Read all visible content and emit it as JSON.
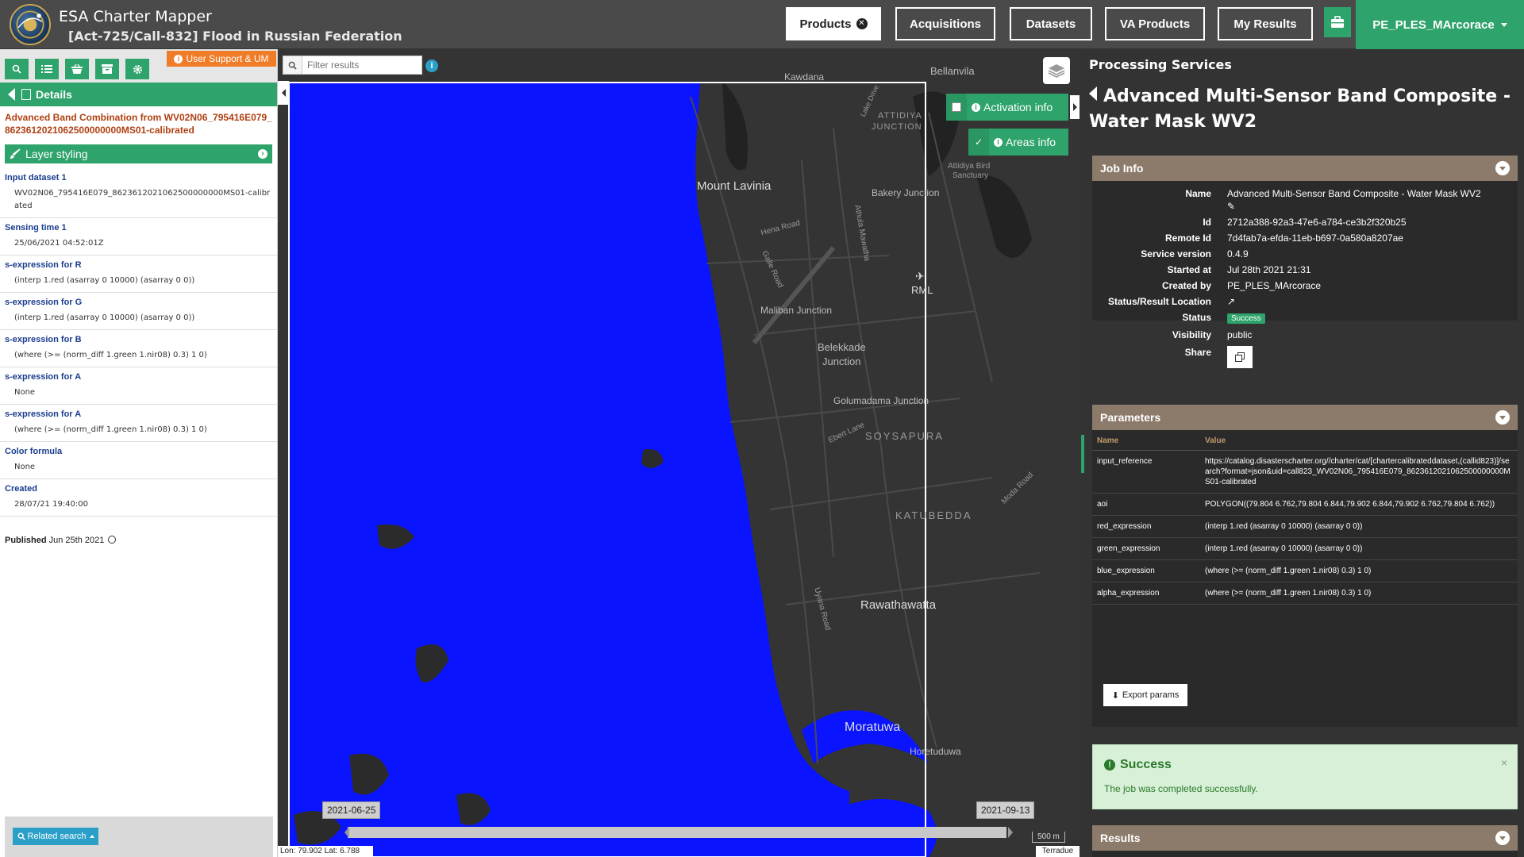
{
  "app": {
    "title": "ESA Charter Mapper",
    "subtitle": "[Act-725/Call-832] Flood in Russian Federation"
  },
  "nav": {
    "products": "Products",
    "acquisitions": "Acquisitions",
    "datasets": "Datasets",
    "va_products": "VA Products",
    "my_results": "My Results",
    "user": "PE_PLES_MArcorace"
  },
  "left": {
    "support": "User Support & UM",
    "details": "Details",
    "product_name": "Advanced Band Combination from WV02N06_795416E079_8623612021062500000000MS01-calibrated",
    "layer_styling": "Layer styling",
    "props": [
      {
        "key": "Input dataset 1",
        "value": "WV02N06_795416E079_8623612021062500000000MS01-calibrated"
      },
      {
        "key": "Sensing time 1",
        "value": "25/06/2021 04:52:01Z"
      },
      {
        "key": "s-expression for R",
        "value": "(interp 1.red (asarray 0 10000) (asarray 0 0))"
      },
      {
        "key": "s-expression for G",
        "value": "(interp 1.red (asarray 0 10000) (asarray 0 0))"
      },
      {
        "key": "s-expression for B",
        "value": "(where (>= (norm_diff 1.green 1.nir08) 0.3) 1 0)"
      },
      {
        "key": "s-expression for A",
        "value": "None"
      },
      {
        "key": "s-expression for A",
        "value": "(where (>= (norm_diff 1.green 1.nir08) 0.3) 1 0)"
      },
      {
        "key": "Color formula",
        "value": "None"
      },
      {
        "key": "Created",
        "value": "28/07/21 19:40:00"
      }
    ],
    "published_label": "Published",
    "published_date": "Jun 25th 2021",
    "related_search": "Related search"
  },
  "map": {
    "filter_placeholder": "Filter results",
    "activation_info": "Activation info",
    "areas_info": "Areas info",
    "labels": {
      "kawdana": "Kawdana",
      "bellanvila": "Bellanvila",
      "attidiya": "ATTIDIYA",
      "junction": "JUNCTION",
      "mount_lavinia": "Mount Lavinia",
      "bird_1": "Attidiya Bird",
      "bird_2": "Sanctuary",
      "bakery": "Bakery Junction",
      "hena": "Hena Road",
      "galle": "Galle Road",
      "athula": "Athula Mawatha",
      "rml": "RML",
      "maliban": "Maliban Junction",
      "belekkade_1": "Belekkade",
      "belekkade_2": "Junction",
      "golumadama": "Golumadama Junction",
      "ebert": "Ebert Lane",
      "soysapura": "SOYSAPURA",
      "katubedda": "KATUBEDDA",
      "moda": "Moda Road",
      "rawathawatta": "Rawathawatta",
      "uyana": "Uyana Road",
      "moratuwa": "Moratuwa",
      "horetuduwa": "Horetuduwa",
      "lake_drive": "Lake Drive"
    },
    "time_start": "2021-06-25",
    "time_end": "2021-09-13",
    "scale": "500 m",
    "coords": "Lon: 79.902 Lat: 6.788",
    "attribution": "Terradue"
  },
  "right": {
    "section": "Processing Services",
    "service_title": "Advanced Multi-Sensor Band Composite - Water Mask WV2",
    "job_info": {
      "title": "Job Info",
      "rows": [
        {
          "k": "Name",
          "v": "Advanced Multi-Sensor Band Composite - Water Mask WV2"
        },
        {
          "k": "Id",
          "v": "2712a388-92a3-47e6-a784-ce3b2f320b25"
        },
        {
          "k": "Remote Id",
          "v": "7d4fab7a-efda-11eb-b697-0a580a8207ae"
        },
        {
          "k": "Service version",
          "v": "0.4.9"
        },
        {
          "k": "Started at",
          "v": "Jul 28th 2021 21:31"
        },
        {
          "k": "Created by",
          "v": "PE_PLES_MArcorace"
        },
        {
          "k": "Status/Result Location",
          "v": ""
        },
        {
          "k": "Status",
          "v": "Success"
        },
        {
          "k": "Visibility",
          "v": "public"
        },
        {
          "k": "Share",
          "v": ""
        }
      ]
    },
    "parameters": {
      "title": "Parameters",
      "col_name": "Name",
      "col_value": "Value",
      "rows": [
        {
          "k": "input_reference",
          "v": "https://catalog.disasterscharter.org//charter/cat/[chartercalibrateddataset,(callid823)]/search?format=json&uid=call823_WV02N06_795416E079_8623612021062500000000MS01-calibrated"
        },
        {
          "k": "aoi",
          "v": "POLYGON((79.804 6.762,79.804 6.844,79.902 6.844,79.902 6.762,79.804 6.762))"
        },
        {
          "k": "red_expression",
          "v": "(interp 1.red (asarray 0 10000) (asarray 0 0))"
        },
        {
          "k": "green_expression",
          "v": "(interp 1.red (asarray 0 10000) (asarray 0 0))"
        },
        {
          "k": "blue_expression",
          "v": "(where (>= (norm_diff 1.green 1.nir08) 0.3) 1 0)"
        },
        {
          "k": "alpha_expression",
          "v": "(where (>= (norm_diff 1.green 1.nir08) 0.3) 1 0)"
        }
      ],
      "export": "Export params"
    },
    "success": {
      "title": "Success",
      "message": "The job was completed successfully."
    },
    "results": "Results"
  },
  "colors": {
    "green": "#2ea36b",
    "orange": "#f07c28",
    "water": "#0a14ff",
    "card_head": "#8c7b6b"
  }
}
